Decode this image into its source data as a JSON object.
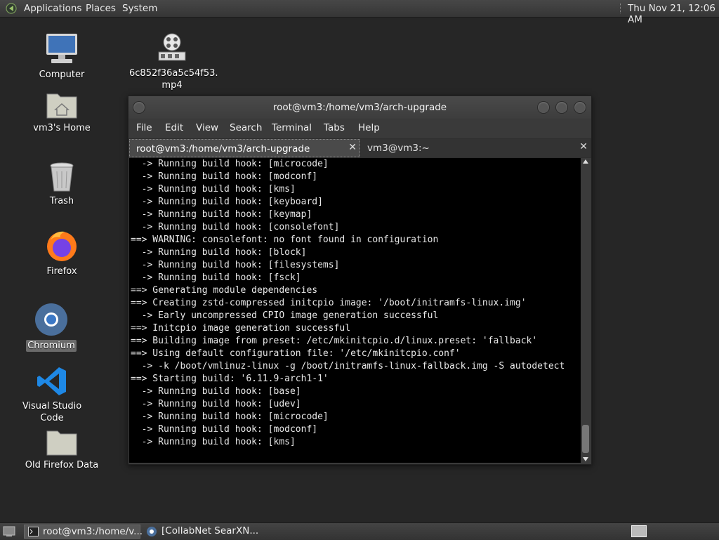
{
  "top_panel": {
    "menus": [
      "Applications",
      "Places",
      "System"
    ],
    "clock": "Thu Nov 21, 12:06 AM"
  },
  "desktop_icons": [
    {
      "label": "Computer",
      "icon": "computer-icon"
    },
    {
      "label": "6c852f36a5c54f53.",
      "label2": "mp4",
      "icon": "video-file-icon"
    },
    {
      "label": "vm3's Home",
      "icon": "home-folder-icon"
    },
    {
      "label": "Trash",
      "icon": "trash-icon"
    },
    {
      "label": "Firefox",
      "icon": "firefox-icon"
    },
    {
      "label": "Chromium",
      "icon": "chromium-icon",
      "selected": true
    },
    {
      "label": "Visual Studio Code",
      "icon": "vscode-icon"
    },
    {
      "label": "Old Firefox Data",
      "icon": "folder-icon"
    }
  ],
  "terminal": {
    "title": "root@vm3:/home/vm3/arch-upgrade",
    "menu": [
      "File",
      "Edit",
      "View",
      "Search",
      "Terminal",
      "Tabs",
      "Help"
    ],
    "tabs": [
      {
        "label": "root@vm3:/home/vm3/arch-upgrade",
        "active": true
      },
      {
        "label": "vm3@vm3:~",
        "active": false
      }
    ],
    "lines": [
      "  -> Running build hook: [microcode]",
      "  -> Running build hook: [modconf]",
      "  -> Running build hook: [kms]",
      "  -> Running build hook: [keyboard]",
      "  -> Running build hook: [keymap]",
      "  -> Running build hook: [consolefont]",
      "==> WARNING: consolefont: no font found in configuration",
      "  -> Running build hook: [block]",
      "  -> Running build hook: [filesystems]",
      "  -> Running build hook: [fsck]",
      "==> Generating module dependencies",
      "==> Creating zstd-compressed initcpio image: '/boot/initramfs-linux.img'",
      "  -> Early uncompressed CPIO image generation successful",
      "==> Initcpio image generation successful",
      "==> Building image from preset: /etc/mkinitcpio.d/linux.preset: 'fallback'",
      "==> Using default configuration file: '/etc/mkinitcpio.conf'",
      "  -> -k /boot/vmlinuz-linux -g /boot/initramfs-linux-fallback.img -S autodetect",
      "==> Starting build: '6.11.9-arch1-1'",
      "  -> Running build hook: [base]",
      "  -> Running build hook: [udev]",
      "  -> Running build hook: [microcode]",
      "  -> Running build hook: [modconf]",
      "  -> Running build hook: [kms]"
    ]
  },
  "taskbar": {
    "items": [
      {
        "label": "root@vm3:/home/v...",
        "icon": "terminal-icon",
        "active": true
      },
      {
        "label": "[CollabNet SearXN...",
        "icon": "chromium-icon",
        "active": false
      }
    ]
  },
  "colors": {
    "desktop_bg": "#262626",
    "terminal_bg": "#000000",
    "terminal_fg": "#e8e8e8",
    "selection_bg": "#6a6a6a"
  }
}
